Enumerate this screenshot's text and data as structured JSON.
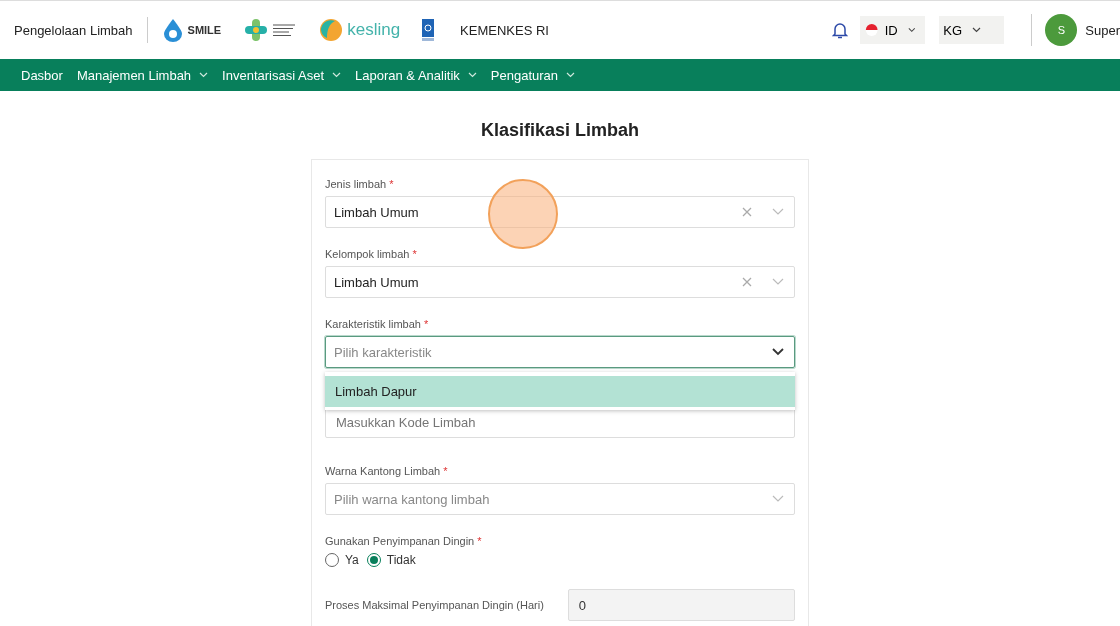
{
  "header": {
    "app_title": "Pengelolaan Limbah",
    "logos": [
      {
        "kind": "smile",
        "text": "SMILE"
      },
      {
        "kind": "kemenkes"
      },
      {
        "kind": "kesling",
        "text": "kesling"
      },
      {
        "kind": "undp"
      }
    ],
    "org": "KEMENKES RI",
    "language": "ID",
    "unit": "KG",
    "avatar_initial": "S",
    "user_name": "Super"
  },
  "nav": [
    {
      "label": "Dasbor",
      "has_menu": false
    },
    {
      "label": "Manajemen Limbah",
      "has_menu": true
    },
    {
      "label": "Inventarisasi Aset",
      "has_menu": true
    },
    {
      "label": "Laporan & Analitik",
      "has_menu": true
    },
    {
      "label": "Pengaturan",
      "has_menu": true
    }
  ],
  "page_title": "Klasifikasi Limbah",
  "fields": [
    {
      "kind": "select",
      "label": "Jenis limbah",
      "required_mark": "*",
      "value": "Limbah Umum",
      "clearable": true
    },
    {
      "kind": "select",
      "label": "Kelompok limbah",
      "required_mark": "*",
      "value": "Limbah Umum",
      "clearable": true
    },
    {
      "kind": "select",
      "label": "Karakteristik limbah",
      "required_mark": "*",
      "placeholder": "Pilih karakteristik",
      "focused": true,
      "clearable": false,
      "options": [
        {
          "label": "Limbah Dapur",
          "selected": true
        }
      ]
    },
    {
      "kind": "input",
      "placeholder": "Masukkan Kode Limbah"
    },
    {
      "kind": "select",
      "label": "Warna Kantong Limbah",
      "required_mark": "*",
      "placeholder": "Pilih warna kantong limbah",
      "clearable": false
    },
    {
      "kind": "radio",
      "label": "Gunakan Penyimpanan Dingin",
      "required_mark": "*",
      "options": [
        {
          "label": "Ya",
          "selected": false
        },
        {
          "label": "Tidak",
          "selected": true
        }
      ]
    },
    {
      "kind": "number",
      "label": "Proses Maksimal Penyimpanan Dingin (Hari)",
      "value": "0",
      "disabled": true
    }
  ]
}
